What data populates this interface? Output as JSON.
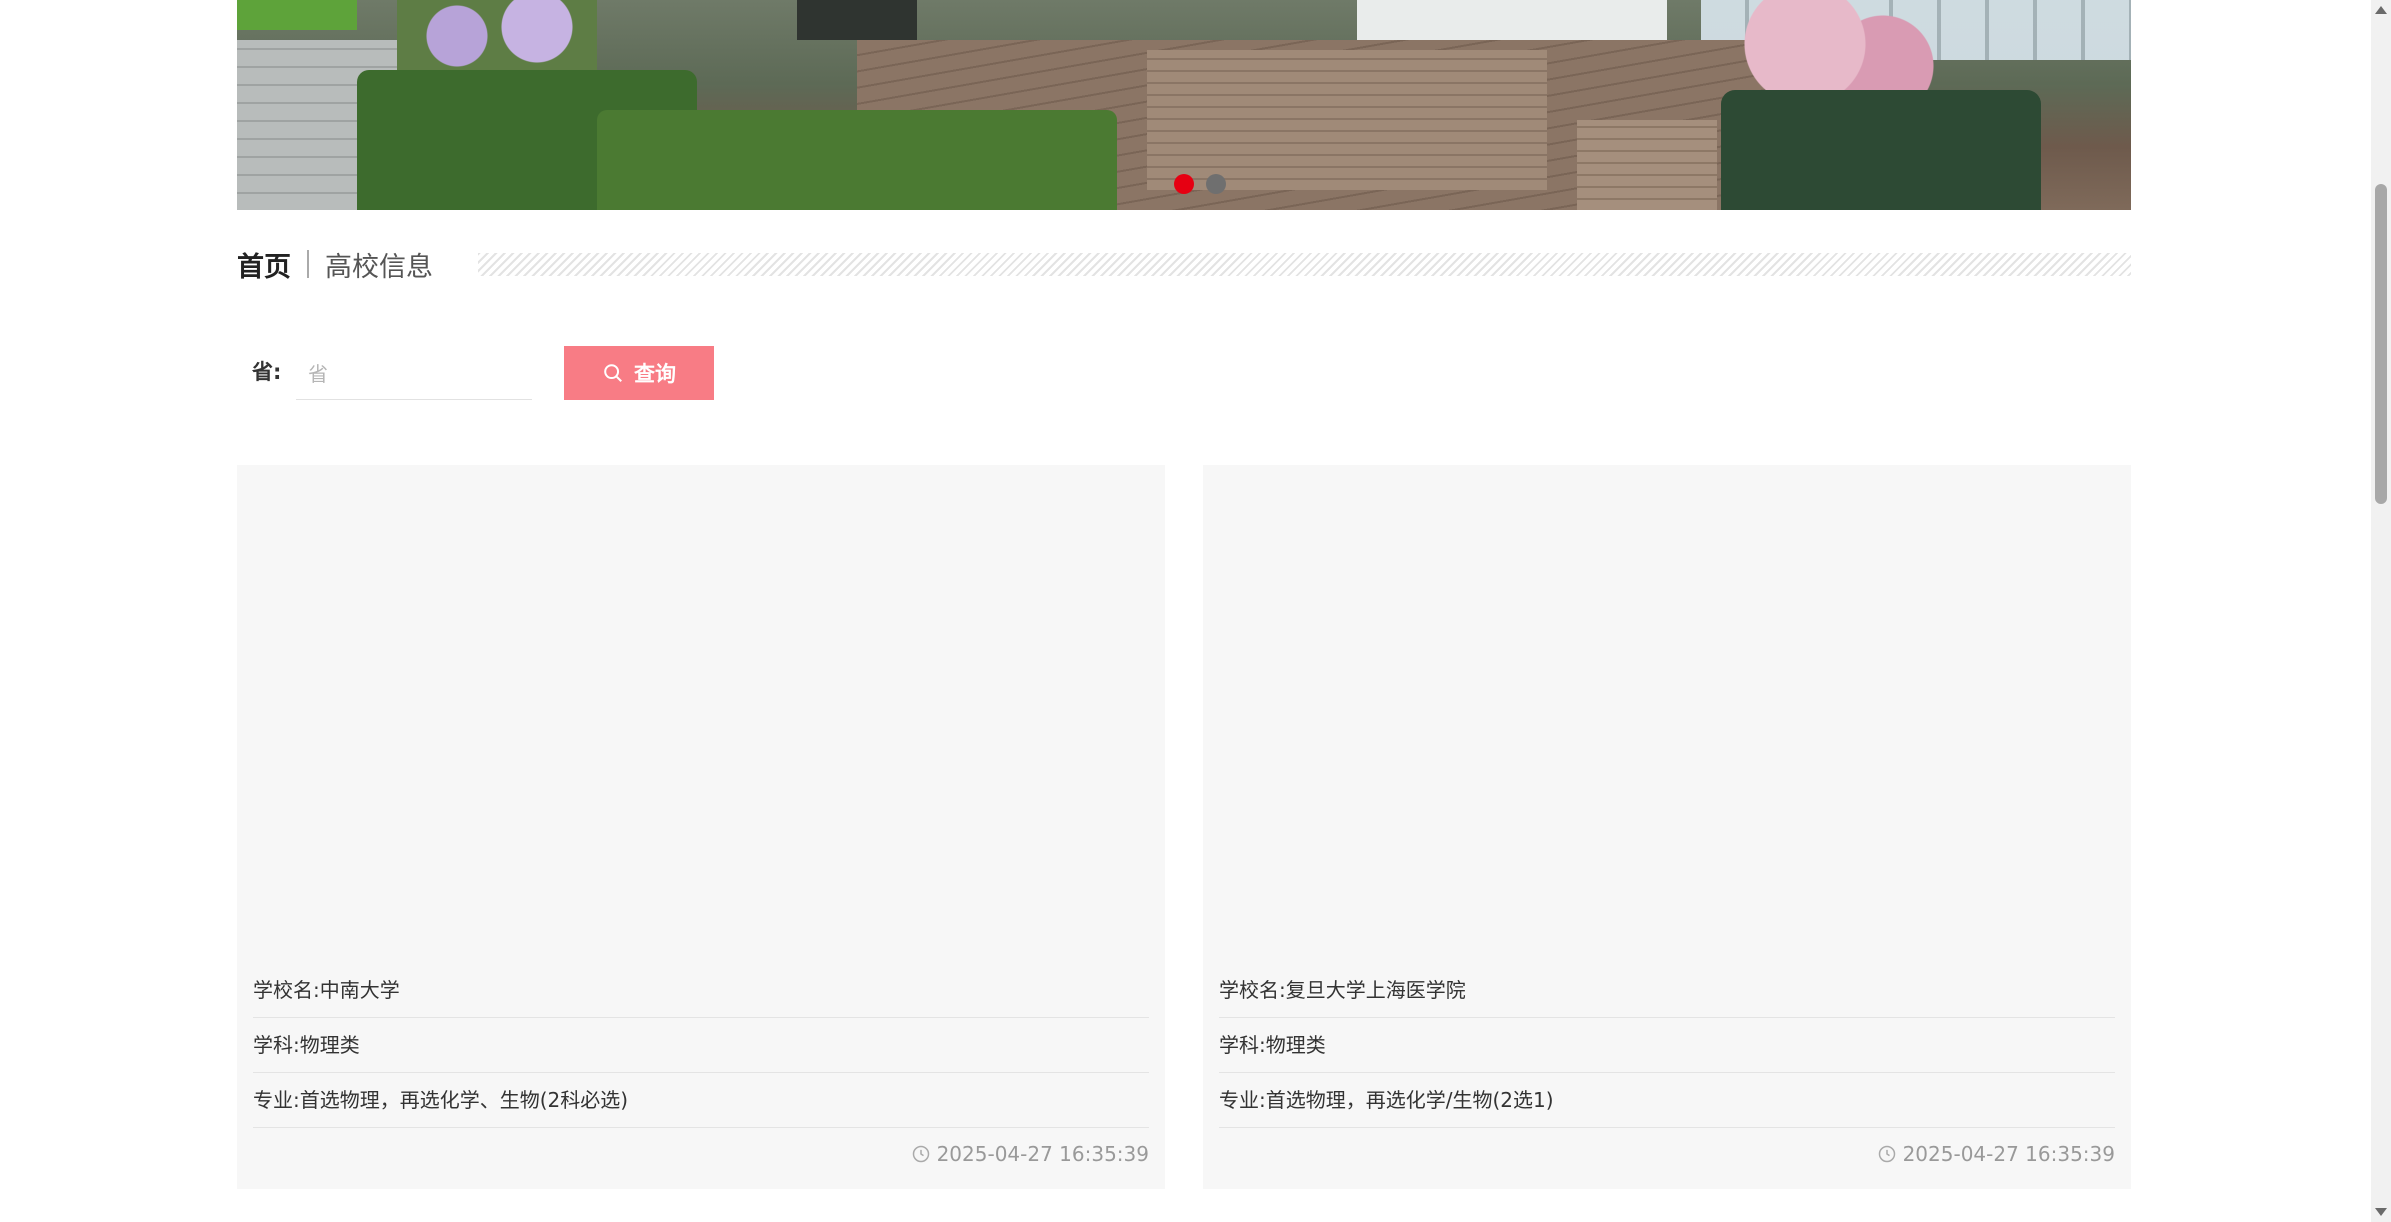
{
  "banner": {
    "dots": [
      {
        "active": true
      },
      {
        "active": false
      }
    ]
  },
  "breadcrumb": {
    "home": "首页",
    "current": "高校信息"
  },
  "search": {
    "label": "省:",
    "placeholder": "省",
    "value": "",
    "button_label": "查询"
  },
  "cards": [
    {
      "school": "学校名:中南大学",
      "subject": "学科:物理类",
      "major": "专业:首选物理，再选化学、生物(2科必选)",
      "time": "2025-04-27 16:35:39"
    },
    {
      "school": "学校名:复旦大学上海医学院",
      "subject": "学科:物理类",
      "major": "专业:首选物理，再选化学/生物(2选1)",
      "time": "2025-04-27 16:35:39"
    }
  ],
  "colors": {
    "accent": "#f87c85",
    "dot_active": "#e60012",
    "card_bg": "#f7f7f7"
  }
}
